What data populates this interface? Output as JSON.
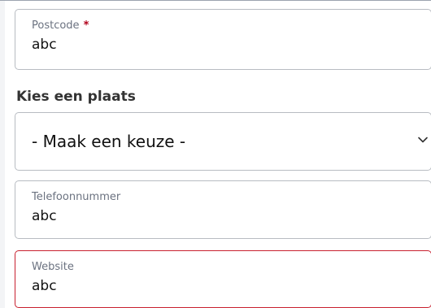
{
  "form": {
    "postcode": {
      "label": "Postcode",
      "required_marker": "*",
      "value": "abc"
    },
    "place": {
      "heading": "Kies een plaats",
      "selected": "- Maak een keuze -"
    },
    "phone": {
      "label": "Telefoonnummer",
      "value": "abc"
    },
    "website": {
      "label": "Website",
      "value": "abc",
      "state": "error"
    }
  },
  "colors": {
    "border": "#b8bcc2",
    "error_border": "#c8202f",
    "required": "#b1001a",
    "label": "#6b7280"
  },
  "icons": {
    "select_indicator": "chevron-down-icon"
  }
}
